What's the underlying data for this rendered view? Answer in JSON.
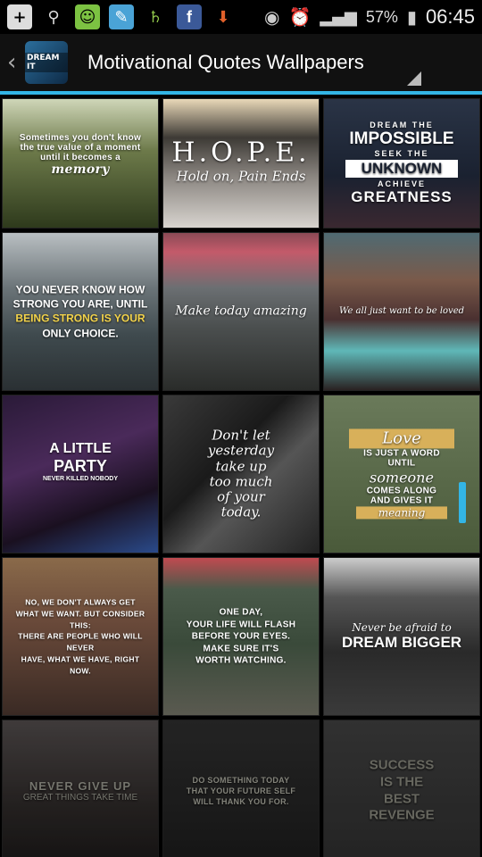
{
  "status_bar": {
    "icons": [
      "add-icon",
      "usb-icon",
      "android-icon",
      "app-notification-icon",
      "saturn-icon",
      "facebook-icon",
      "download-icon"
    ],
    "battery": "57%",
    "time": "06:45"
  },
  "action_bar": {
    "back_glyph": "‹",
    "app_icon_text": "DREAM IT",
    "title": "Motivational Quotes Wallpapers"
  },
  "wallpapers": [
    {
      "lines": [
        "Sometimes you don't know",
        "the true value of a moment",
        "until it becomes a",
        "memory"
      ]
    },
    {
      "lines": [
        "H.O.P.E.",
        "Hold on, Pain Ends"
      ]
    },
    {
      "lines": [
        "DREAM THE",
        "IMPOSSIBLE",
        "SEEK THE",
        "UNKNOWN",
        "ACHIEVE",
        "GREATNESS"
      ]
    },
    {
      "lines": [
        "YOU NEVER KNOW HOW",
        "STRONG YOU ARE, UNTIL",
        "BEING STRONG IS YOUR",
        "ONLY CHOICE."
      ]
    },
    {
      "lines": [
        "Make today amazing"
      ]
    },
    {
      "lines": [
        "We all just want to be loved"
      ]
    },
    {
      "lines": [
        "A LITTLE",
        "PARTY",
        "NEVER KILLED NOBODY"
      ]
    },
    {
      "lines": [
        "Don't let",
        "yesterday",
        "take up",
        "too much",
        "of your",
        "today."
      ]
    },
    {
      "lines": [
        "Love",
        "IS JUST A WORD",
        "UNTIL",
        "someone",
        "COMES ALONG",
        "AND GIVES IT",
        "meaning"
      ]
    },
    {
      "lines": [
        "NO, WE DON'T ALWAYS GET",
        "WHAT WE WANT. BUT CONSIDER THIS:",
        "THERE ARE PEOPLE WHO WILL NEVER",
        "HAVE, WHAT WE HAVE, RIGHT NOW."
      ]
    },
    {
      "lines": [
        "ONE DAY,",
        "YOUR LIFE WILL FLASH",
        "BEFORE YOUR EYES.",
        "MAKE SURE IT'S",
        "WORTH WATCHING."
      ]
    },
    {
      "lines": [
        "Never be afraid to",
        "DREAM BIGGER"
      ]
    },
    {
      "lines": [
        "NEVER GIVE UP",
        "GREAT THINGS TAKE TIME"
      ]
    },
    {
      "lines": [
        "DO SOMETHING TODAY",
        "THAT YOUR FUTURE SELF",
        "WILL THANK YOU FOR."
      ]
    },
    {
      "lines": [
        "SUCCESS",
        "IS THE",
        "BEST",
        "REVENGE"
      ]
    }
  ],
  "colors": {
    "accent": "#33b5e5"
  }
}
